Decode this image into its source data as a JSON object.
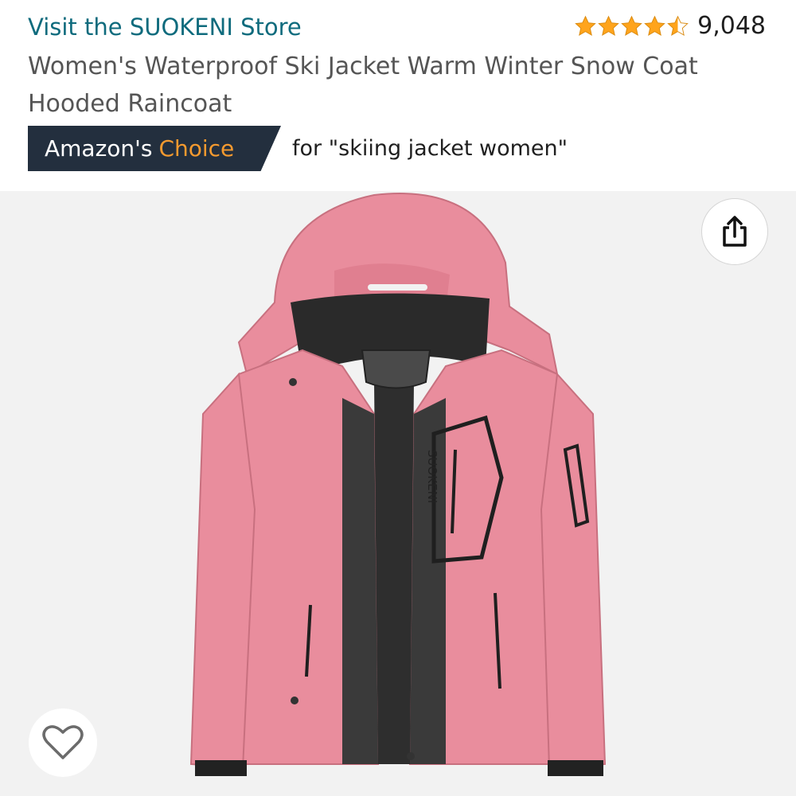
{
  "header": {
    "store_link": "Visit the SUOKENI Store",
    "rating_stars": 4.5,
    "review_count": "9,048",
    "product_title": "Women's Waterproof Ski Jacket Warm Winter Snow Coat Hooded Raincoat"
  },
  "badge": {
    "prefix": "Amazon's",
    "highlight": "Choice",
    "context": "for \"skiing jacket women\""
  },
  "product_image": {
    "brand_text": "SUOKENI"
  },
  "colors": {
    "link": "#0f6b7d",
    "badge_bg": "#232f3e",
    "badge_highlight": "#f59a2f",
    "star": "#ffa41c",
    "jacket": "#e98d9d",
    "image_bg": "#f2f2f2"
  },
  "icons": {
    "share": "share-icon",
    "favorite": "heart-icon",
    "star": "star-icon"
  }
}
